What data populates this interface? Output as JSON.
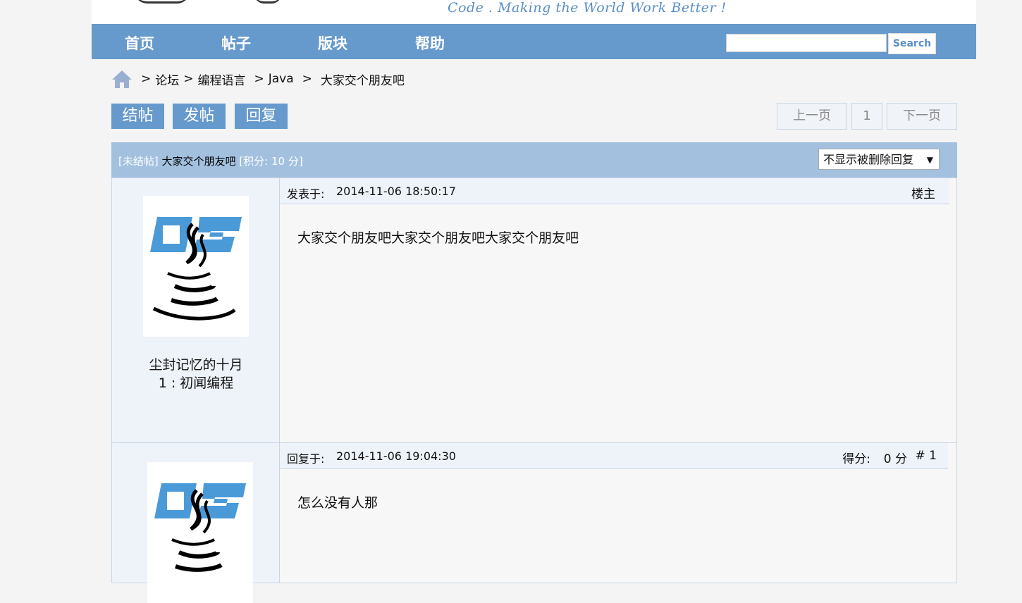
{
  "header": {
    "slogan": "Code . Making the World Work Better !"
  },
  "nav": {
    "items": [
      "首页",
      "帖子",
      "版块",
      "帮助"
    ],
    "search_button": "Search",
    "search_value": ""
  },
  "breadcrumb": {
    "items": [
      "论坛",
      "编程语言",
      "Java",
      "大家交个朋友吧"
    ],
    "separator": ">"
  },
  "actions": {
    "close": "结帖",
    "new_post": "发帖",
    "reply": "回复"
  },
  "pager": {
    "prev": "上一页",
    "page": "1",
    "next": "下一页"
  },
  "topic": {
    "status_tag": "[未结帖]",
    "title": "大家交个朋友吧",
    "points_tag": "[积分: 10 分]",
    "filter_selected": "不显示被删除回复"
  },
  "posts": [
    {
      "meta_label": "发表于:",
      "time": "2014-11-06 18:50:17",
      "right_label": "楼主",
      "body": "大家交个朋友吧大家交个朋友吧大家交个朋友吧",
      "user": "尘封记忆的十月",
      "rank": "1 : 初闻编程"
    },
    {
      "meta_label": "回复于:",
      "time": "2014-11-06 19:04:30",
      "score_label": "得分:",
      "score_value": "0 分",
      "floor": "# 1",
      "body": "怎么没有人那"
    }
  ],
  "colors": {
    "nav": "#6699cc",
    "topic_head": "#a3c1df",
    "panel": "#eef3fa",
    "border": "#c8d6e5"
  }
}
